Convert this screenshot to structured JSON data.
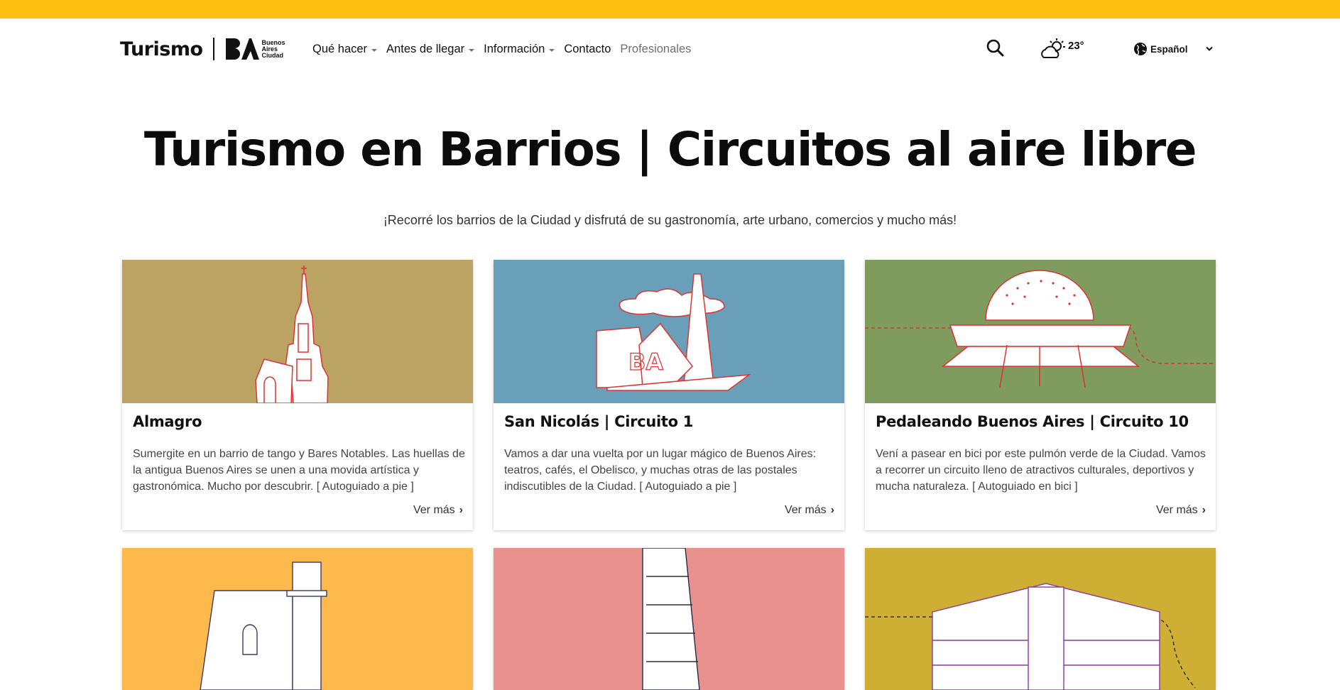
{
  "brand": {
    "name": "Turismo",
    "ba_line1": "Buenos",
    "ba_line2": "Aires",
    "ba_line3": "Ciudad",
    "accent": "#fdc010"
  },
  "nav": {
    "items": [
      {
        "label": "Qué hacer",
        "dropdown": true
      },
      {
        "label": "Antes de llegar",
        "dropdown": true
      },
      {
        "label": "Información",
        "dropdown": true
      },
      {
        "label": "Contacto",
        "dropdown": false
      },
      {
        "label": "Profesionales",
        "dropdown": false
      }
    ],
    "search_icon": "search-icon",
    "weather_icon": "partly-sunny-icon",
    "temperature": "23°",
    "language": "Español",
    "globe_icon": "globe-icon"
  },
  "hero": {
    "title": "Turismo en Barrios | Circuitos al aire libre",
    "subtitle": "¡Recorré los barrios de la Ciudad y disfrutá de su gastronomía, arte urbano, comercios y mucho más!"
  },
  "cards": [
    {
      "title": "Almagro",
      "description": "Sumergite en un barrio de tango y Bares Notables. Las huellas de la antigua Buenos Aires se unen a una movida artística y gastronómica. Mucho por descubrir. [ Autoguiado a pie ]",
      "more": "Ver más",
      "bg": "#bba363"
    },
    {
      "title": "San Nicolás | Circuito 1",
      "description": "Vamos a dar una vuelta por un lugar mágico de Buenos Aires: teatros, cafés, el Obelisco, y muchas otras de las postales indiscutibles de la Ciudad. [ Autoguiado a pie ]",
      "more": "Ver más",
      "bg": "#6a9fba"
    },
    {
      "title": "Pedaleando Buenos Aires | Circuito 10",
      "description": "Vení a pasear en bici por este pulmón verde de la Ciudad. Vamos a recorrer un circuito lleno de atractivos culturales, deportivos y mucha naturaleza. [ Autoguiado en bici ]",
      "more": "Ver más",
      "bg": "#7f9b5d"
    },
    {
      "bg": "#fdb94c"
    },
    {
      "bg": "#e8918f"
    },
    {
      "bg": "#cfae34"
    }
  ]
}
